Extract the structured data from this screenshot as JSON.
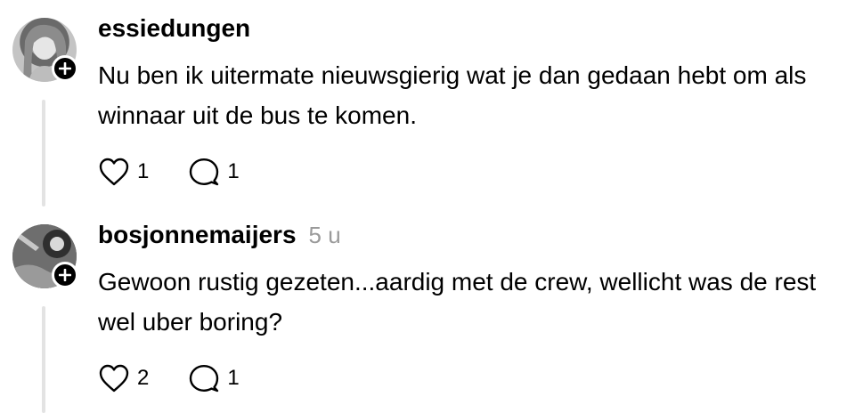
{
  "posts": [
    {
      "username": "essiedungen",
      "timestamp": "",
      "body": "Nu ben ik uitermate nieuwsgierig wat je dan gedaan hebt om als winnaar uit de bus te komen.",
      "likes": "1",
      "replies": "1",
      "icons": {
        "like": "heart-icon",
        "reply": "speech-bubble-icon",
        "follow": "plus-icon"
      }
    },
    {
      "username": "bosjonnemaijers",
      "timestamp": "5 u",
      "body": "Gewoon rustig gezeten...aardig met de crew, wellicht was de rest wel uber boring?",
      "likes": "2",
      "replies": "1",
      "icons": {
        "like": "heart-icon",
        "reply": "speech-bubble-icon",
        "follow": "plus-icon"
      }
    }
  ],
  "colors": {
    "text": "#000000",
    "muted": "#9a9a9a",
    "thread_line": "#e3e3e3",
    "background": "#ffffff"
  }
}
